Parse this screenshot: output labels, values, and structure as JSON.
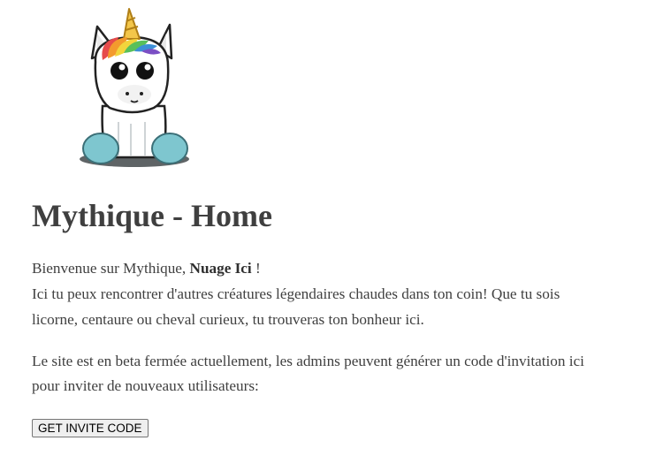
{
  "page": {
    "logo_icon": "unicorn-icon",
    "title": "Mythique - Home",
    "intro": {
      "greeting_prefix": "Bienvenue sur Mythique, ",
      "username": "Nuage Ici",
      "greeting_suffix": " !",
      "body": "Ici tu peux rencontrer d'autres créatures légendaires chaudes dans ton coin! Que tu sois licorne, centaure ou cheval curieux, tu trouveras ton bonheur ici."
    },
    "beta_notice": "Le site est en beta fermée actuellement, les admins peuvent générer un code d'invitation ici pour inviter de nouveaux utilisateurs:",
    "invite_button_label": "GET INVITE CODE"
  }
}
